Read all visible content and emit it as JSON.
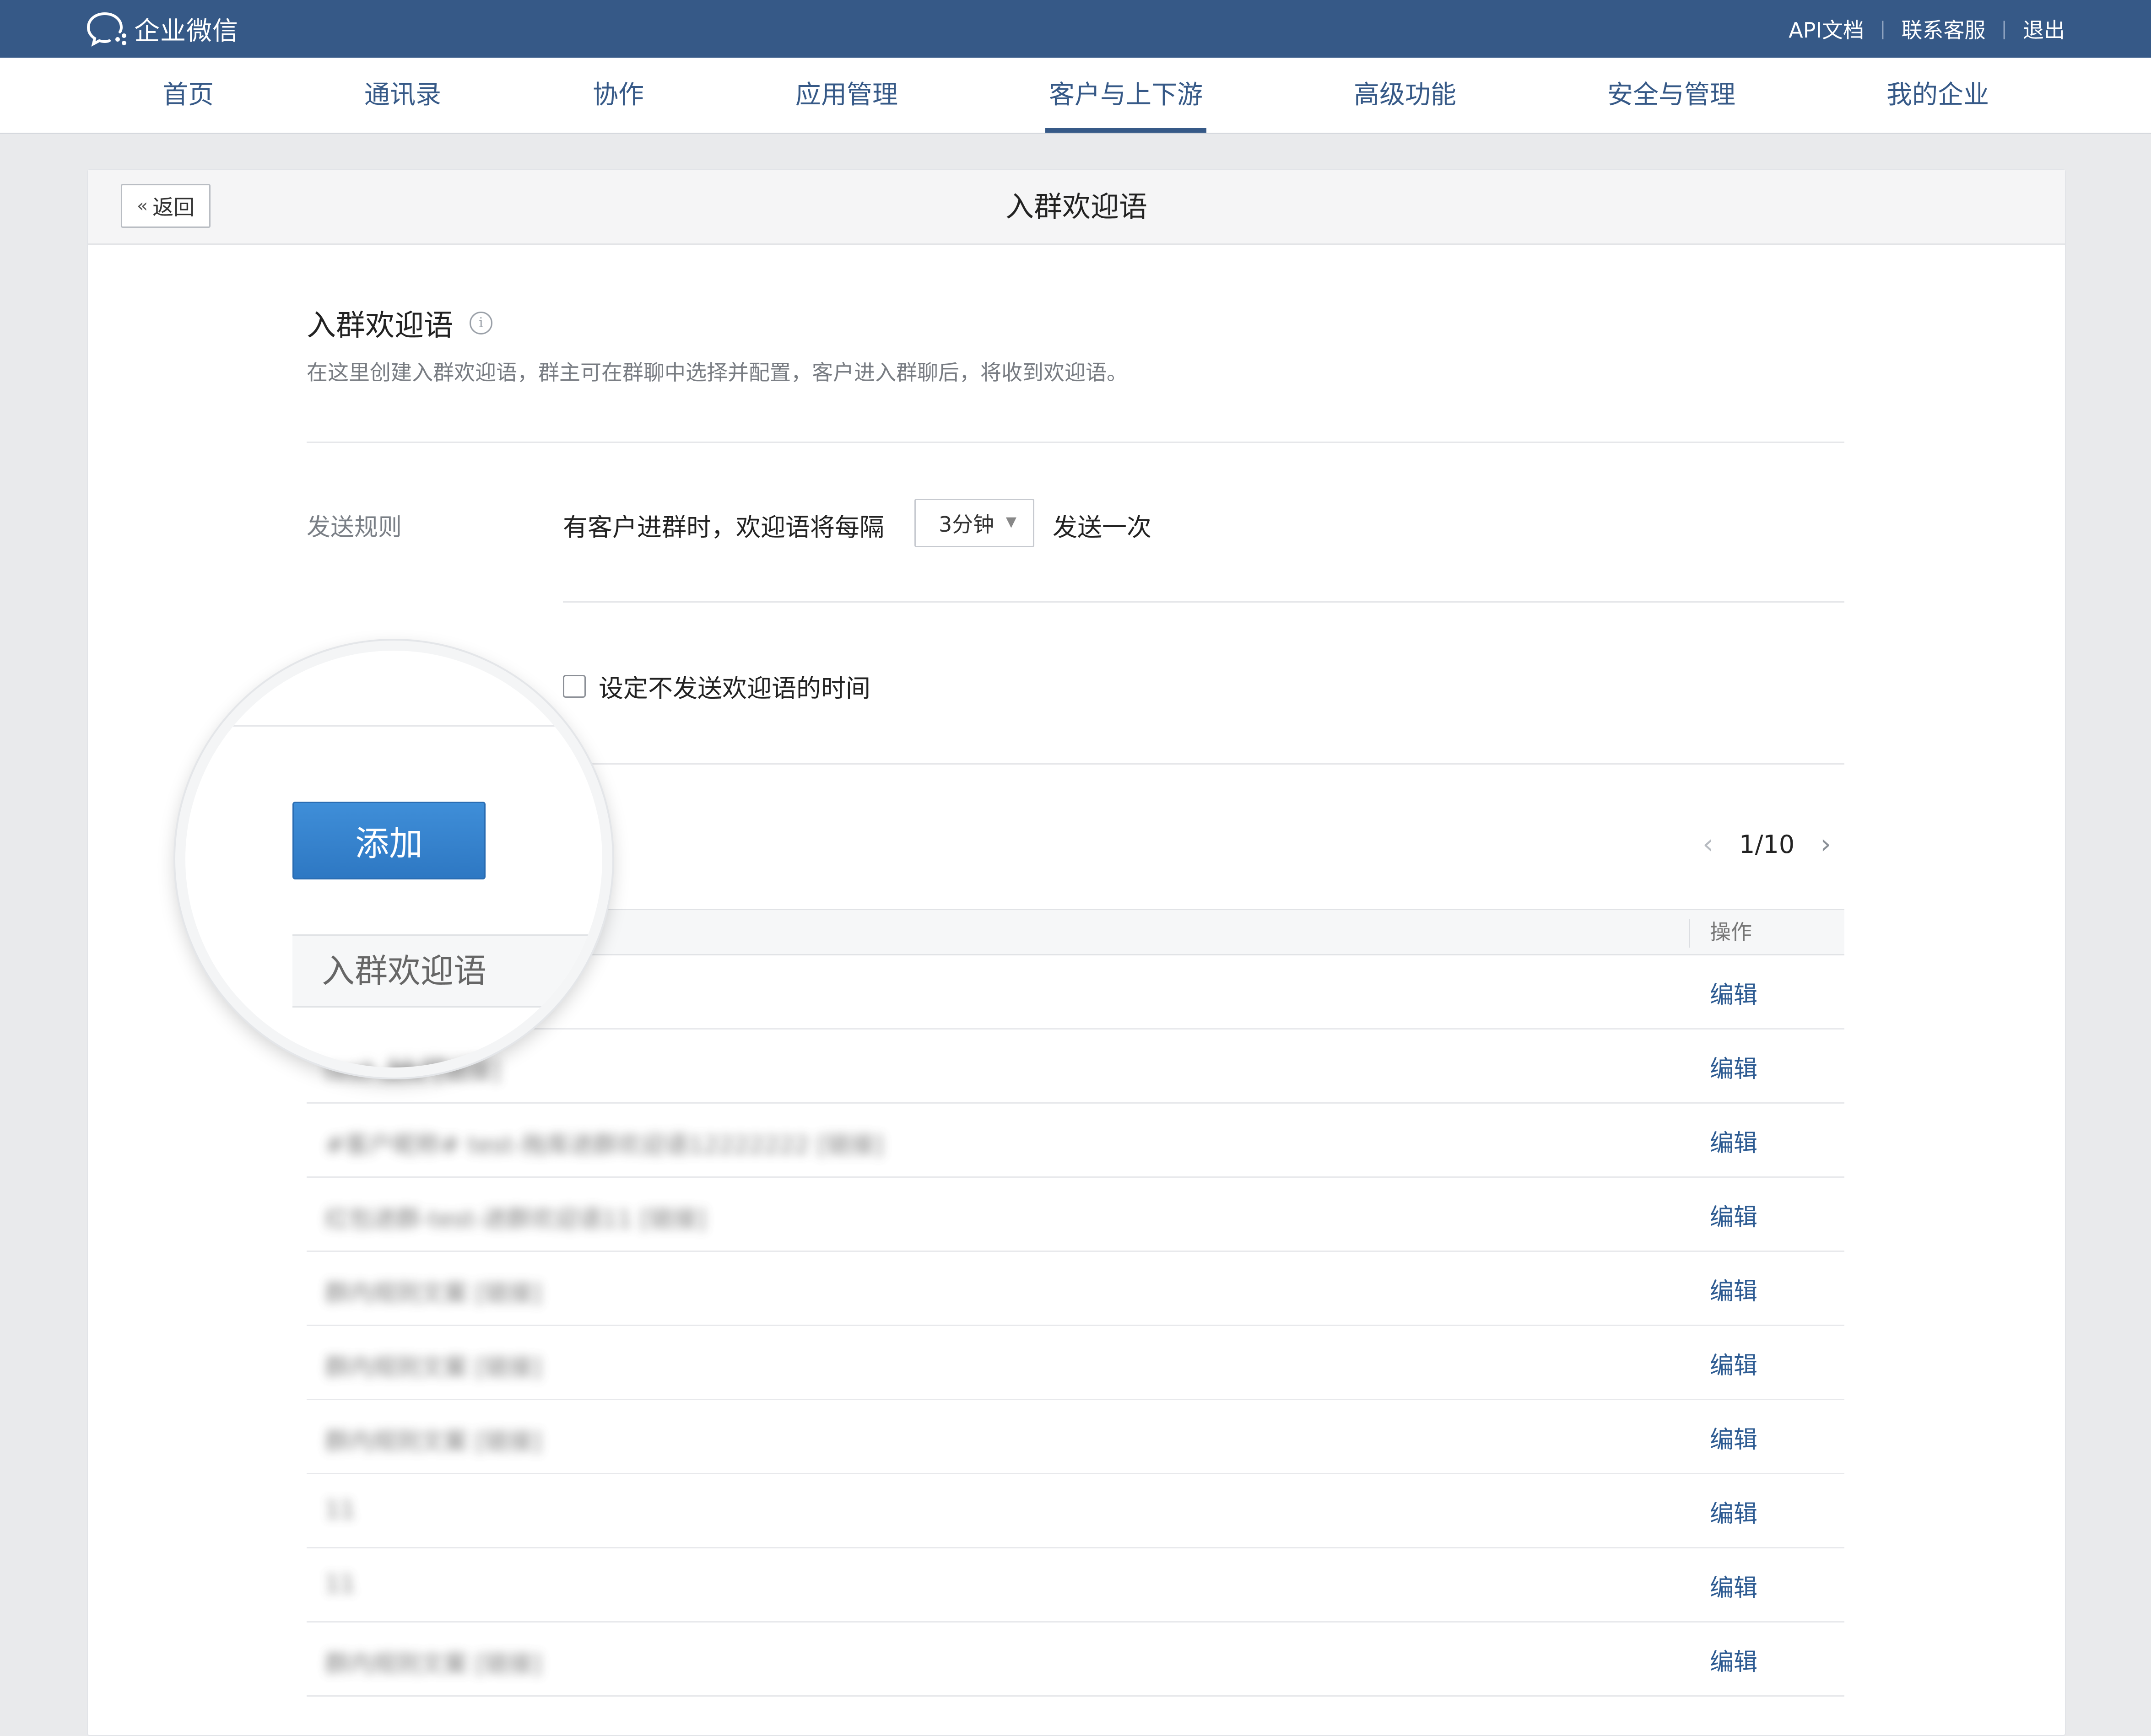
{
  "topbar": {
    "brand": "企业微信",
    "links": [
      "API文档",
      "联系客服",
      "退出"
    ],
    "separator": "|"
  },
  "nav": {
    "items": [
      "首页",
      "通讯录",
      "协作",
      "应用管理",
      "客户与上下游",
      "高级功能",
      "安全与管理",
      "我的企业"
    ],
    "active_index": 4
  },
  "page": {
    "back_label": "返回",
    "title": "入群欢迎语"
  },
  "section": {
    "title": "入群欢迎语",
    "description": "在这里创建入群欢迎语，群主可在群聊中选择并配置，客户进入群聊后，将收到欢迎语。"
  },
  "rule": {
    "label": "发送规则",
    "text_before": "有客户进群时，欢迎语将每隔",
    "interval_value": "3分钟",
    "text_after": "发送一次",
    "no_send_time_label": "设定不发送欢迎语的时间",
    "no_send_time_checked": false
  },
  "toolbar": {
    "add_label": "添加"
  },
  "pager": {
    "text": "1/10"
  },
  "table": {
    "column_name": "入群欢迎语",
    "column_action": "操作",
    "rows": [
      {
        "name": "test-抽奖活动 [链接]",
        "action": "编辑"
      },
      {
        "name": "test-抽奖 [链接]",
        "action": "编辑"
      },
      {
        "name": "#客户昵称# test-拖库进群欢迎语12222222 [链接]",
        "action": "编辑"
      },
      {
        "name": "红包进群-test-进群欢迎语11 [链接]",
        "action": "编辑"
      },
      {
        "name": "群内规则文案 [链接]",
        "action": "编辑"
      },
      {
        "name": "群内规则文案 [链接]",
        "action": "编辑"
      },
      {
        "name": "群内规则文案 [链接]",
        "action": "编辑"
      },
      {
        "name": "11",
        "action": "编辑"
      },
      {
        "name": "11",
        "action": "编辑"
      },
      {
        "name": "群内规则文案 [链接]",
        "action": "编辑"
      }
    ]
  },
  "colors": {
    "topbar_bg": "#365987",
    "nav_text": "#365987",
    "link": "#2d5b92",
    "primary_button": "#2e78c3",
    "page_bg": "#e9eaec"
  },
  "icons": {
    "brand": "wecom-chat-logo-icon",
    "back": "double-chevron-left-icon",
    "info": "info-circle-icon",
    "select": "caret-down-icon",
    "prev": "chevron-left-icon",
    "next": "chevron-right-icon"
  }
}
